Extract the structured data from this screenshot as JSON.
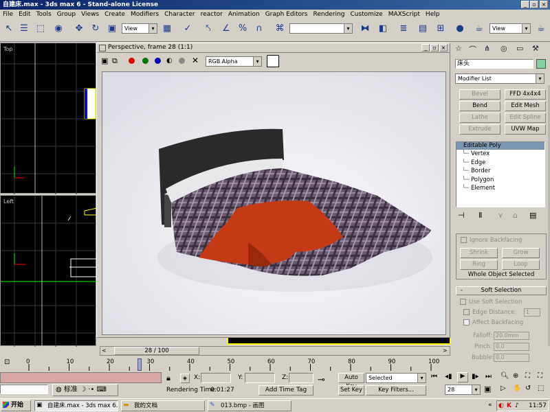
{
  "app": {
    "title": "自建床.max - 3ds max 6 - Stand-alone License"
  },
  "menu": [
    "File",
    "Edit",
    "Tools",
    "Group",
    "Views",
    "Create",
    "Modifiers",
    "Character",
    "reactor",
    "Animation",
    "Graph Editors",
    "Rendering",
    "Customize",
    "MAXScript",
    "Help"
  ],
  "toolbar": {
    "view_dropdown": "View",
    "view_dropdown2": "View",
    "named_sel": ""
  },
  "viewports": {
    "top_label": "Top",
    "left_label": "Left"
  },
  "render_window": {
    "title": "Perspective, frame 28 (1:1)",
    "channel_dropdown": "RGB Alpha"
  },
  "cmd_panel": {
    "object_name": "床头",
    "modifier_list": "Modifier List",
    "buttons": [
      {
        "label": "Bevel",
        "enabled": false
      },
      {
        "label": "FFD 4x4x4",
        "enabled": true
      },
      {
        "label": "Bend",
        "enabled": true
      },
      {
        "label": "Edit Mesh",
        "enabled": true
      },
      {
        "label": "Lathe",
        "enabled": false
      },
      {
        "label": "Edit Spline",
        "enabled": false
      },
      {
        "label": "Extrude",
        "enabled": false
      },
      {
        "label": "UVW Map",
        "enabled": true
      }
    ],
    "stack_top": "Editable Poly",
    "stack_items": [
      "Vertex",
      "Edge",
      "Border",
      "Polygon",
      "Element"
    ],
    "ignore_backfacing": "Ignore Backfacing",
    "shrink": "Shrink",
    "grow": "Grow",
    "ring": "Ring",
    "loop": "Loop",
    "whole_object": "Whole Object Selected",
    "soft_selection_minus": "-",
    "soft_selection": "Soft Selection",
    "use_soft": "Use Soft Selection",
    "edge_distance": "Edge Distance:",
    "edge_distance_val": "1",
    "affect_backfacing": "Affect Backfacing",
    "falloff_label": "Falloff:",
    "falloff_val": "20.0mm",
    "pinch_label": "Pinch:",
    "pinch_val": "0.0",
    "bubble_label": "Bubble:",
    "bubble_val": "0.0"
  },
  "timeline": {
    "slider_label": "28 / 100",
    "ticks": [
      "0",
      "10",
      "20",
      "30",
      "40",
      "50",
      "60",
      "70",
      "80",
      "90",
      "100"
    ]
  },
  "status": {
    "x_label": "X:",
    "y_label": "Y:",
    "z_label": "Z:",
    "rendering_time_label": "Rendering Time",
    "rendering_time_value": "0:01:27",
    "add_time_tag": "Add Time Tag",
    "auto_key": "Auto Key",
    "selected": "Selected",
    "set_key": "Set Key",
    "key_filters": "Key Filters...",
    "frame": "28",
    "ime_label": "标准"
  },
  "taskbar": {
    "start": "开始",
    "tasks": [
      "自建床.max - 3ds max 6...",
      "我的文档",
      "013.bmp - 画图"
    ],
    "clock": "11:57"
  }
}
